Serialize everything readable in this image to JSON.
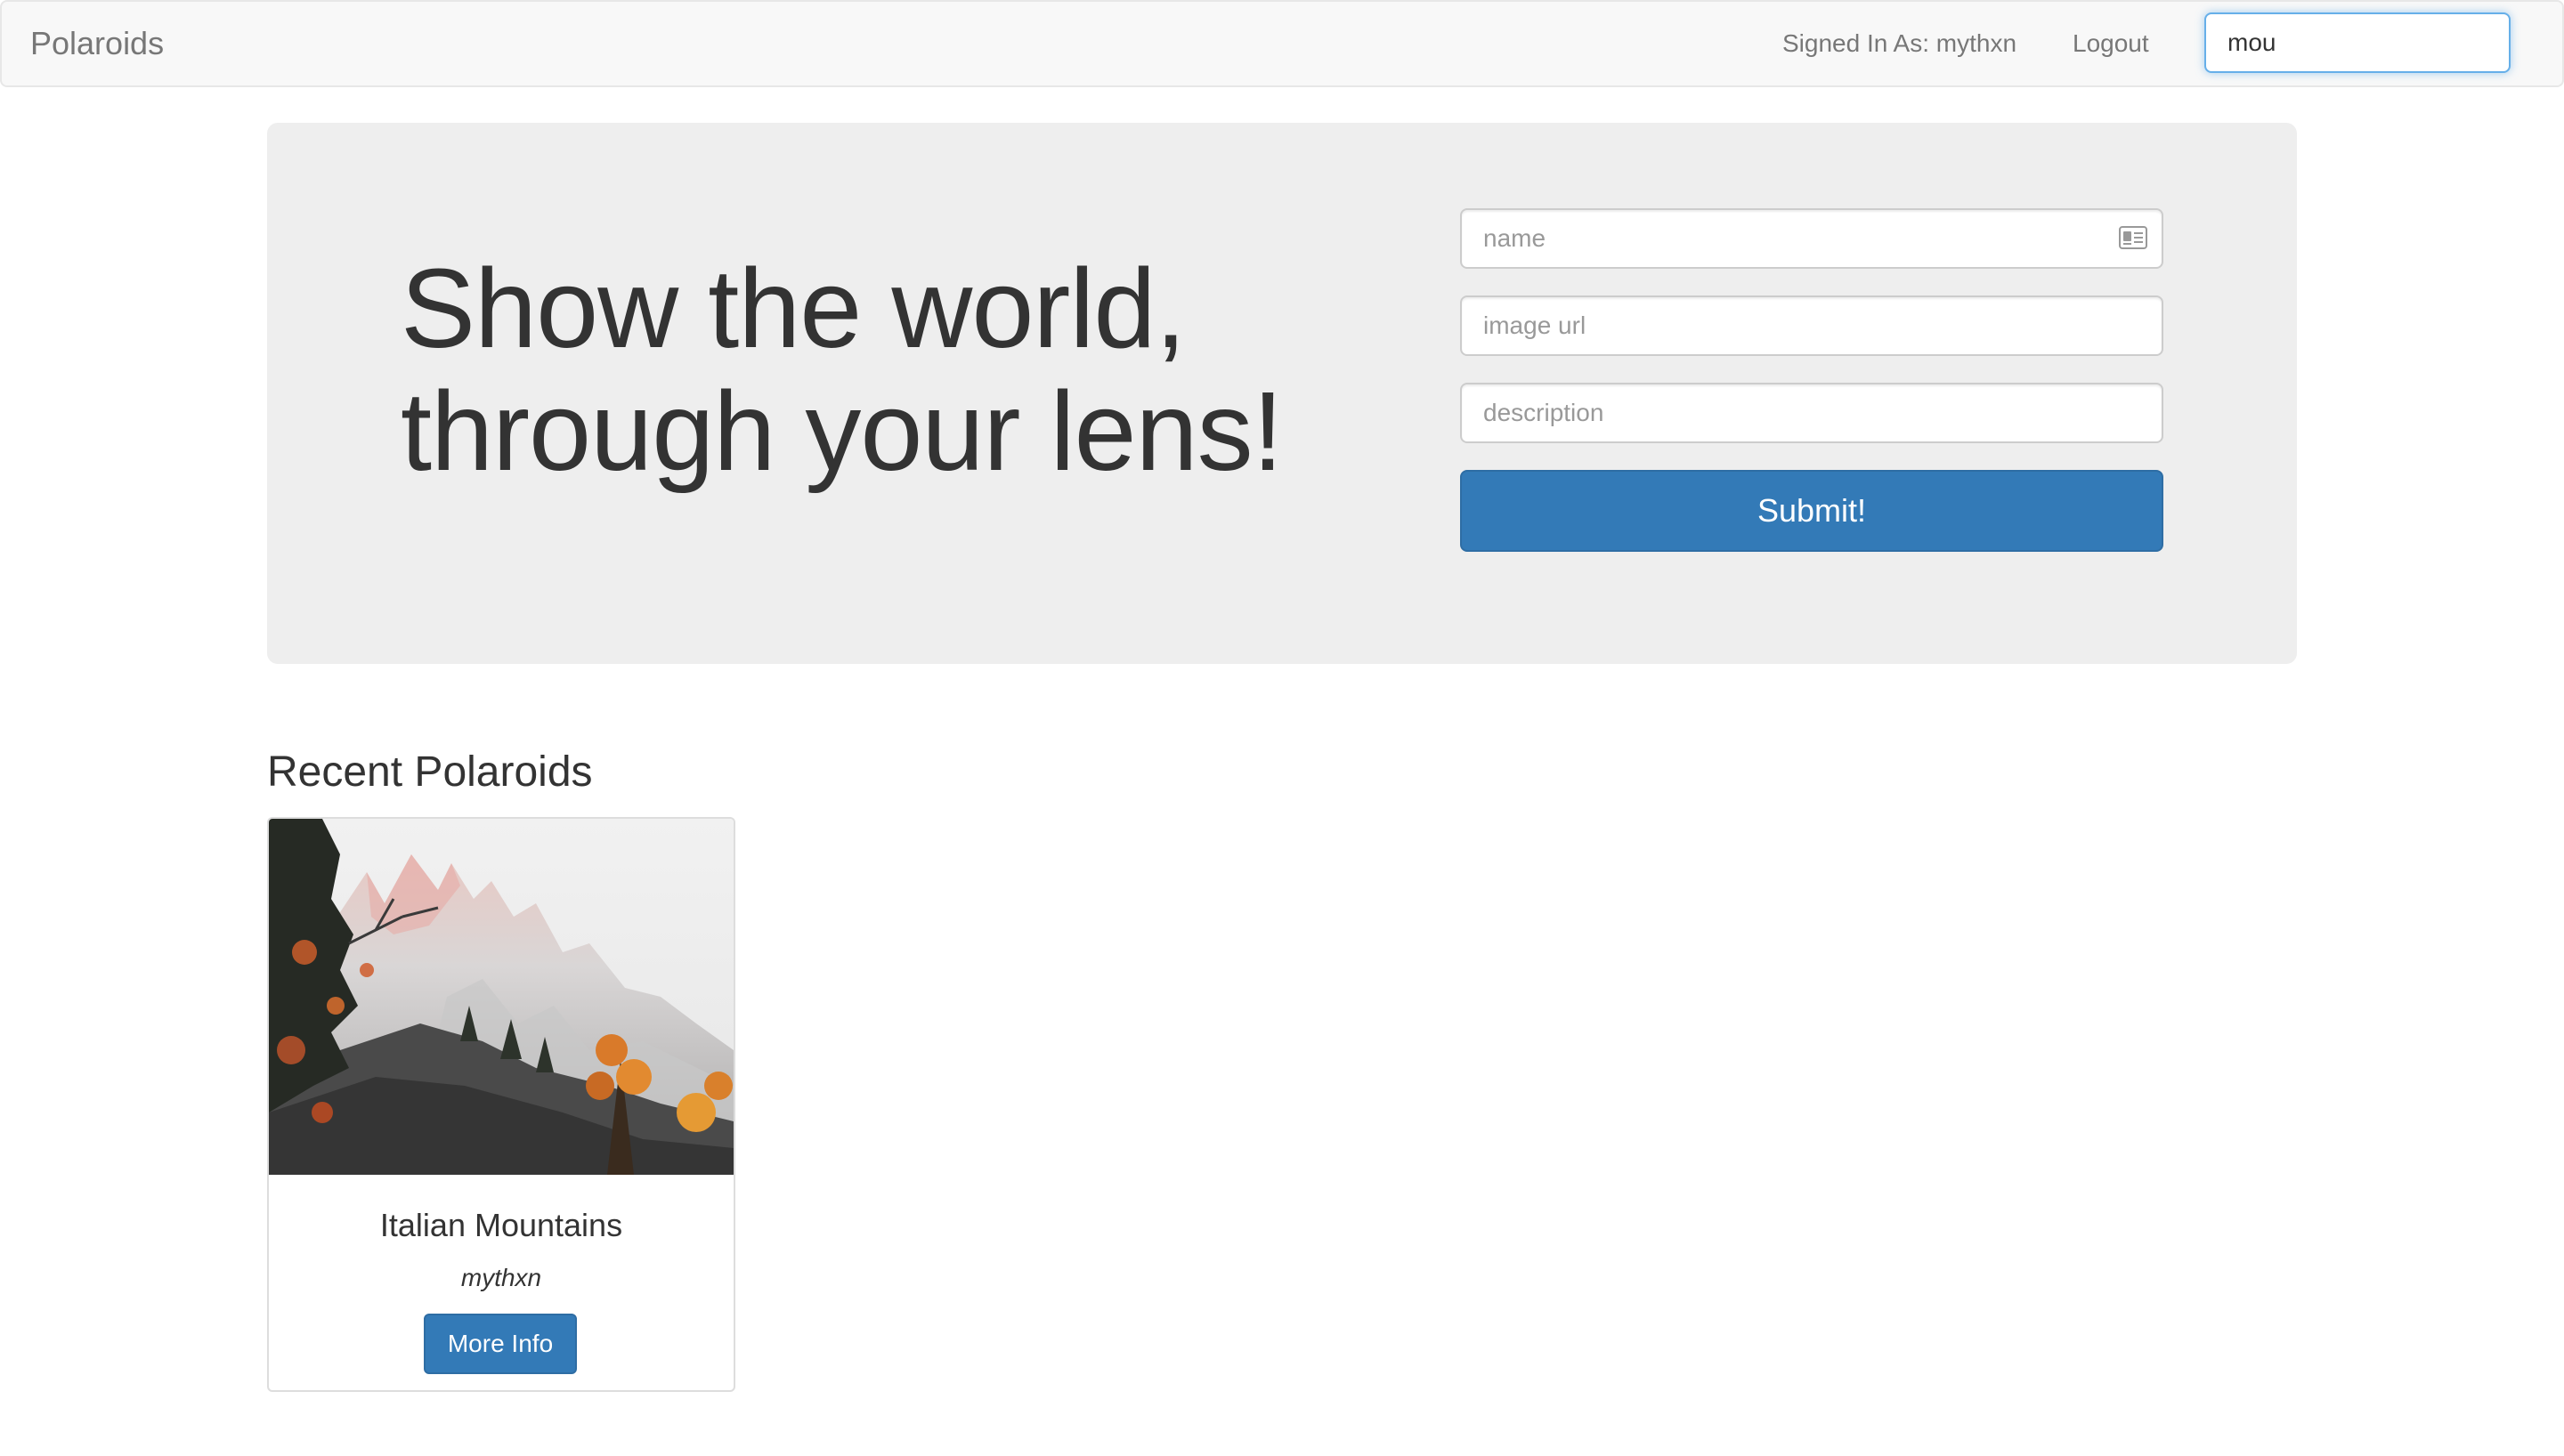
{
  "navbar": {
    "brand": "Polaroids",
    "signed_in_text": "Signed In As: mythxn",
    "logout_label": "Logout",
    "search_value": "mou"
  },
  "hero": {
    "headline_line1": "Show the world,",
    "headline_line2": "through your lens!",
    "form": {
      "name_placeholder": "name",
      "name_icon": "id-card-icon",
      "image_url_placeholder": "image url",
      "description_placeholder": "description",
      "submit_label": "Submit!"
    }
  },
  "recent": {
    "heading": "Recent Polaroids",
    "items": [
      {
        "title": "Italian Mountains",
        "author": "mythxn",
        "button_label": "More Info",
        "image": "mountain-photo"
      }
    ]
  },
  "colors": {
    "primary": "#337ab7",
    "navbar_bg": "#f8f8f8",
    "jumbotron_bg": "#eeeeee",
    "focus_border": "#66afe9"
  }
}
